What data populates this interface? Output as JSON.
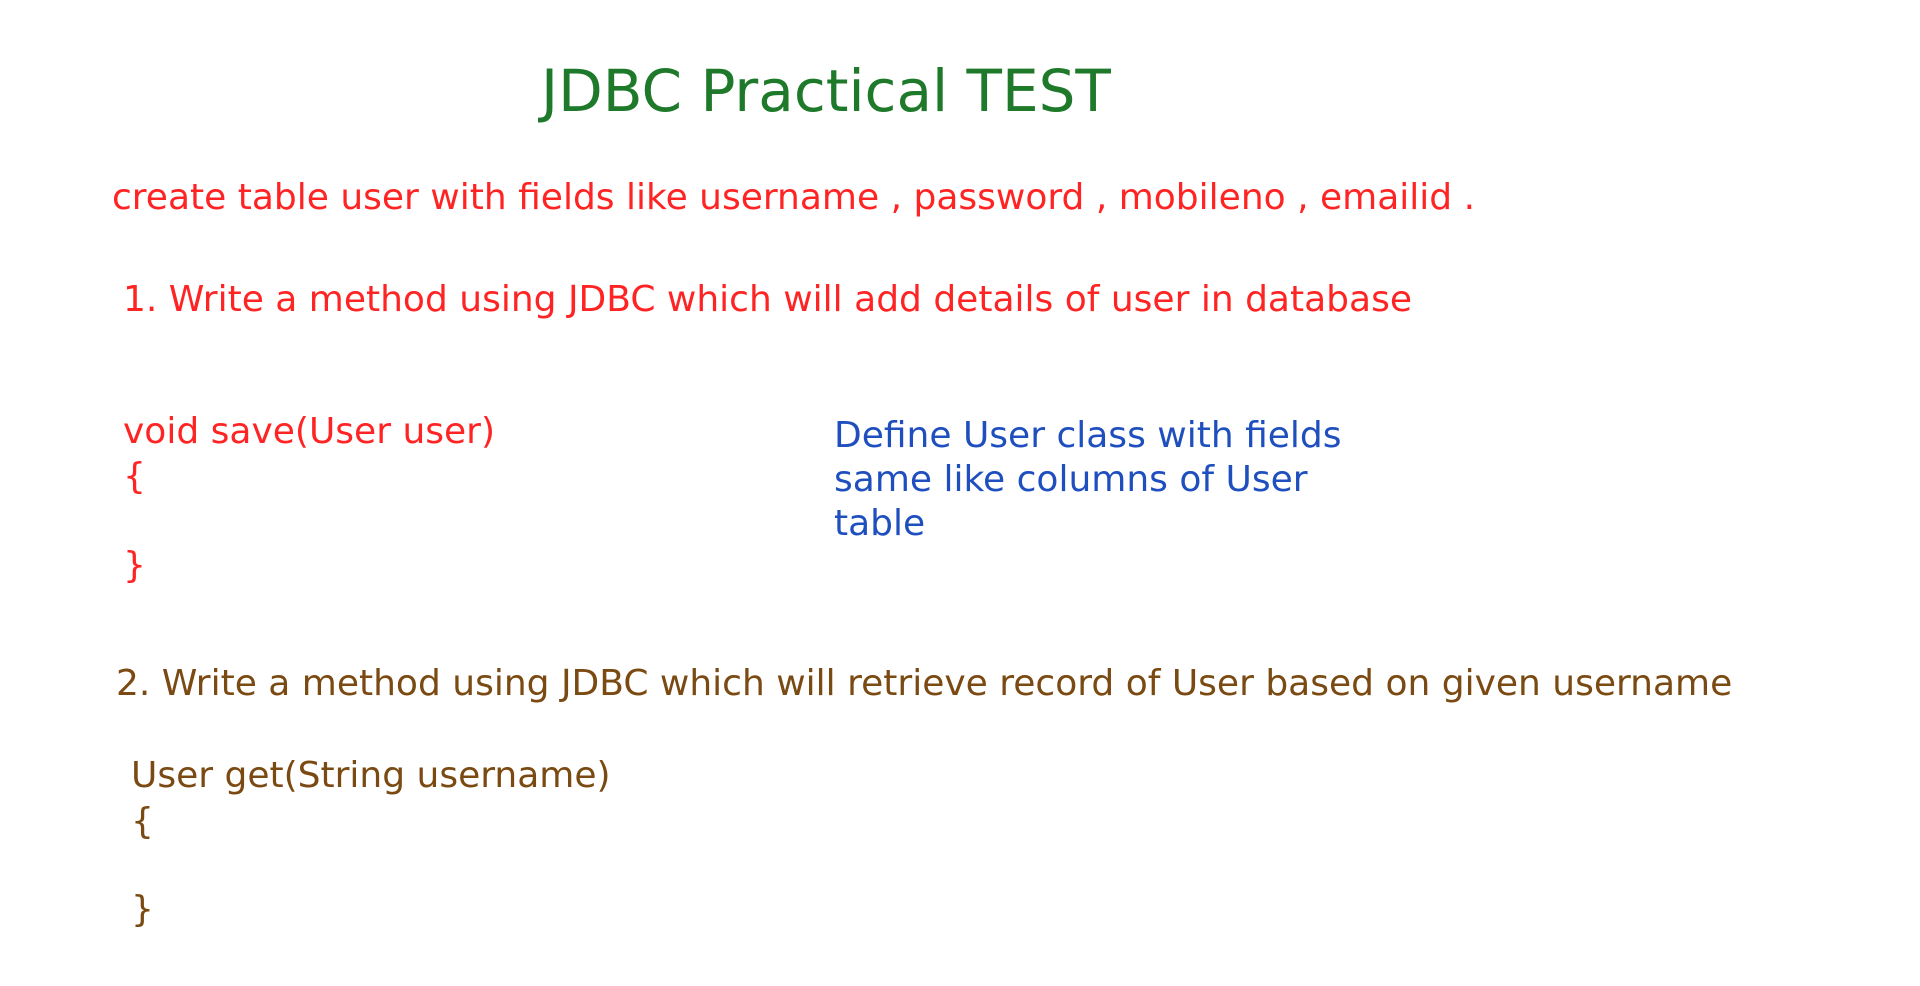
{
  "title": "JDBC Practical TEST",
  "intro": "create table user with fields like username , password , mobileno , emailid .",
  "question1": {
    "text": "1. Write a method using JDBC which will add details of user in database",
    "signature": "void save(User user)",
    "open_brace": "{",
    "close_brace": "}"
  },
  "note": {
    "line1": "Define User class with fields",
    "line2": "same like columns of User",
    "line3": "table"
  },
  "question2": {
    "text": "2. Write a method using JDBC which will retrieve record of User based on given username",
    "signature": "User get(String username)",
    "open_brace": "{",
    "close_brace": "}"
  },
  "colors": {
    "title": "#1e7a2a",
    "question1": "#ff2424",
    "note": "#1f4fbf",
    "question2": "#7a4a12"
  }
}
